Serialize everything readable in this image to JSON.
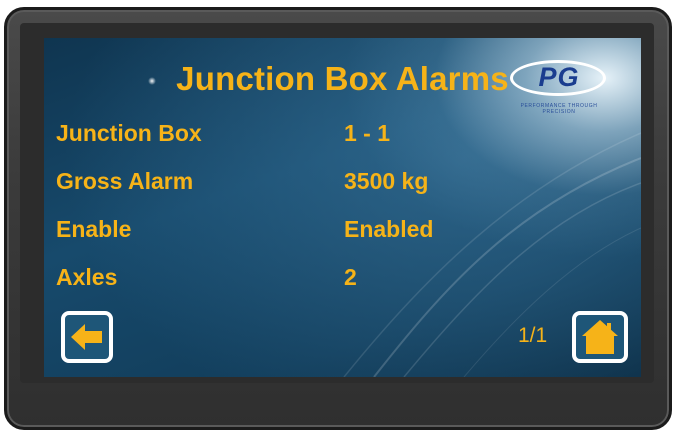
{
  "screen": {
    "title": "Junction Box Alarms",
    "logo": {
      "text": "PG",
      "tagline": "PERFORMANCE THROUGH PRECISION"
    },
    "rows": [
      {
        "label": "Junction Box",
        "value": "1 - 1"
      },
      {
        "label": "Gross Alarm",
        "value": "3500 kg"
      },
      {
        "label": "Enable",
        "value": "Enabled"
      },
      {
        "label": "Axles",
        "value": "2"
      }
    ],
    "page_indicator": "1/1",
    "back_icon": "arrow-left-icon",
    "home_icon": "home-icon"
  },
  "colors": {
    "accent": "#f6b318",
    "button_bg": "#1e5678",
    "button_border": "#ffffff",
    "logo_blue": "#1a3d8f"
  }
}
